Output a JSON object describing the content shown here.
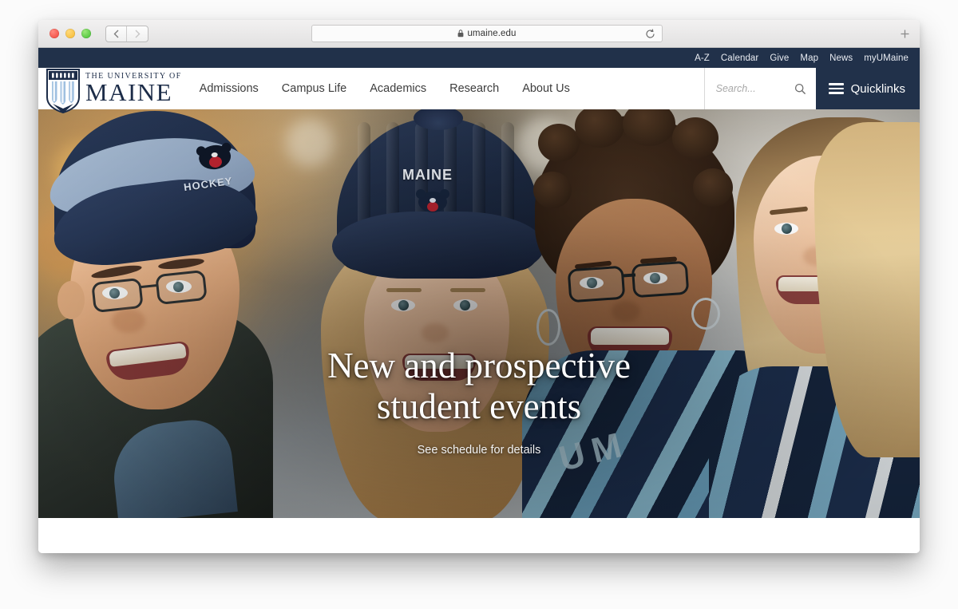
{
  "browser": {
    "url": "umaine.edu",
    "lock_icon": "lock-icon",
    "reload_icon": "reload-icon",
    "back_icon": "chevron-left-icon",
    "forward_icon": "chevron-right-icon",
    "new_tab_icon": "plus-icon",
    "traffic_lights": [
      "close",
      "minimize",
      "maximize"
    ]
  },
  "site": {
    "utility_nav": [
      {
        "label": "A-Z"
      },
      {
        "label": "Calendar"
      },
      {
        "label": "Give"
      },
      {
        "label": "Map"
      },
      {
        "label": "News"
      },
      {
        "label": "myUMaine"
      }
    ],
    "logo": {
      "top_line": "THE UNIVERSITY OF",
      "main_line": "MAINE",
      "crest_year": "1865"
    },
    "main_nav": [
      {
        "label": "Admissions"
      },
      {
        "label": "Campus Life"
      },
      {
        "label": "Academics"
      },
      {
        "label": "Research"
      },
      {
        "label": "About Us"
      }
    ],
    "search": {
      "placeholder": "Search...",
      "value": "",
      "icon": "search-icon"
    },
    "quicklinks": {
      "label": "Quicklinks",
      "icon": "hamburger-icon"
    },
    "hero": {
      "title_line1": "New and prospective",
      "title_line2": "student events",
      "subtitle": "See schedule for details",
      "hat1_logo_text": "HOCKEY",
      "hat2_logo_text": "MAINE",
      "scarf_text": "UM"
    }
  },
  "colors": {
    "navy": "#21314a",
    "white": "#ffffff",
    "nav_text": "#3d3d3d",
    "utility_text": "#e9ecf2",
    "page_background": "#fbfbfb"
  }
}
